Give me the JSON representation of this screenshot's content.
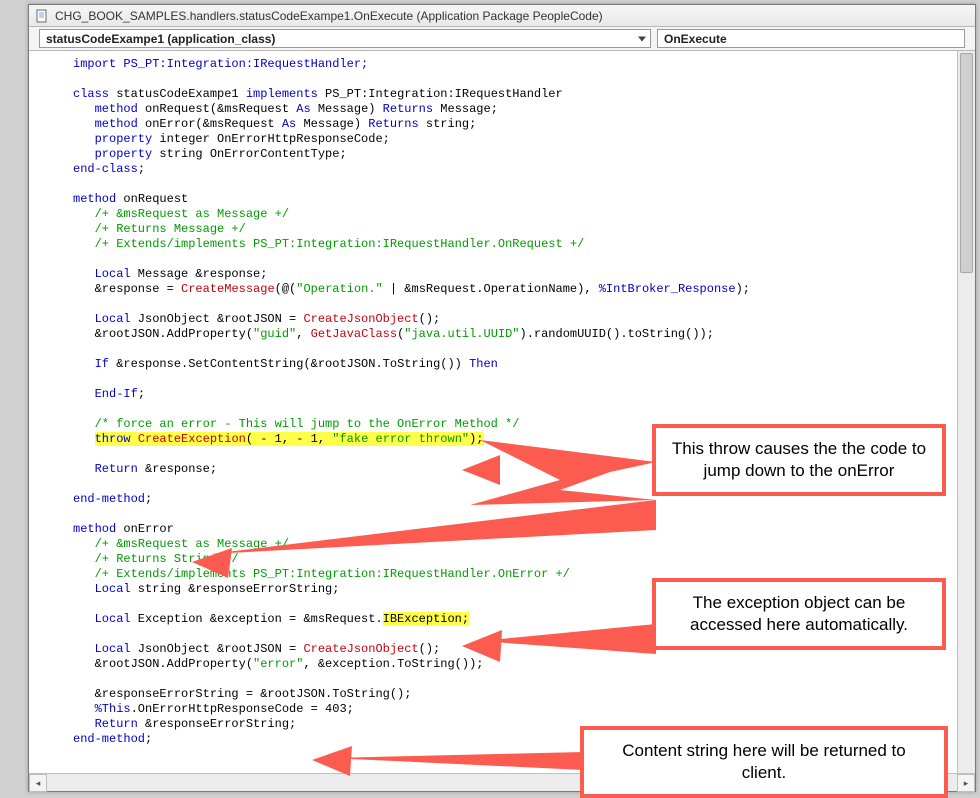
{
  "window": {
    "title": "CHG_BOOK_SAMPLES.handlers.statusCodeExampe1.OnExecute (Application Package PeopleCode)"
  },
  "dropdowns": {
    "left": "statusCodeExampe1    (application_class)",
    "right": "OnExecute"
  },
  "callouts": {
    "c1": "This throw causes the the code to jump down to the onError",
    "c2": "The exception object can be accessed here automatically.",
    "c3": "Content string here will be returned to client."
  },
  "code": {
    "l1": "import PS_PT:Integration:IRequestHandler;",
    "l2": "",
    "l3a": "class",
    "l3b": " statusCodeExampe1 ",
    "l3c": "implements",
    "l3d": " PS_PT:Integration:IRequestHandler",
    "l4a": "   method",
    "l4b": " onRequest(&msRequest ",
    "l4c": "As",
    "l4d": " Message) ",
    "l4e": "Returns",
    "l4f": " Message;",
    "l5a": "   method",
    "l5b": " onError(&msRequest ",
    "l5c": "As",
    "l5d": " Message) ",
    "l5e": "Returns",
    "l5f": " string;",
    "l6a": "   property",
    "l6b": " integer OnErrorHttpResponseCode;",
    "l7a": "   property",
    "l7b": " string OnErrorContentType;",
    "l8": "end-class",
    "l8s": ";",
    "l9": "",
    "l10a": "method",
    "l10b": " onRequest",
    "l11": "   /+ &msRequest as Message +/",
    "l12": "   /+ Returns Message +/",
    "l13": "   /+ Extends/implements PS_PT:Integration:IRequestHandler.OnRequest +/",
    "l14": "",
    "l15a": "   Local",
    "l15b": " Message &response;",
    "l16a": "   &response = ",
    "l16b": "CreateMessage",
    "l16c": "(@(",
    "l16d": "\"Operation.\"",
    "l16e": " | &msRequest.OperationName), ",
    "l16f": "%IntBroker_Response",
    "l16g": ");",
    "l17": "",
    "l18a": "   Local",
    "l18b": " JsonObject &rootJSON = ",
    "l18c": "CreateJsonObject",
    "l18d": "();",
    "l19a": "   &rootJSON.AddProperty(",
    "l19b": "\"guid\"",
    "l19c": ", ",
    "l19d": "GetJavaClass",
    "l19e": "(",
    "l19f": "\"java.util.UUID\"",
    "l19g": ").randomUUID().toString());",
    "l20": "",
    "l21a": "   If",
    "l21b": " &response.SetContentString(&rootJSON.ToString()) ",
    "l21c": "Then",
    "l22": "",
    "l23a": "   End-If",
    "l23b": ";",
    "l24": "",
    "l25": "   /* force an error - This will jump to the OnError Method */",
    "l26a": "   ",
    "l26b": "throw",
    "l26c": " ",
    "l26d": "CreateException",
    "l26e": "( - 1, - 1, ",
    "l26f": "\"fake error thrown\"",
    "l26g": ");",
    "l27": "",
    "l28a": "   Return",
    "l28b": " &response;",
    "l29": "",
    "l30": "end-method",
    "l30s": ";",
    "l31": "",
    "l32a": "method",
    "l32b": " onError",
    "l33": "   /+ &msRequest as Message +/",
    "l34": "   /+ Returns String +/",
    "l35": "   /+ Extends/implements PS_PT:Integration:IRequestHandler.OnError +/",
    "l36a": "   Local",
    "l36b": " string &responseErrorString;",
    "l37": "",
    "l38a": "   Local",
    "l38b": " Exception &exception = &msRequest.",
    "l38c": "IBException;",
    "l39": "",
    "l40a": "   Local",
    "l40b": " JsonObject &rootJSON = ",
    "l40c": "CreateJsonObject",
    "l40d": "();",
    "l41a": "   &rootJSON.AddProperty(",
    "l41b": "\"error\"",
    "l41c": ", &exception.ToString());",
    "l42": "",
    "l43": "   &responseErrorString = &rootJSON.ToString();",
    "l44a": "   %This",
    "l44b": ".OnErrorHttpResponseCode = 403;",
    "l45a": "   Return",
    "l45b": " &responseErrorString;",
    "l46": "end-method",
    "l46s": ";"
  }
}
